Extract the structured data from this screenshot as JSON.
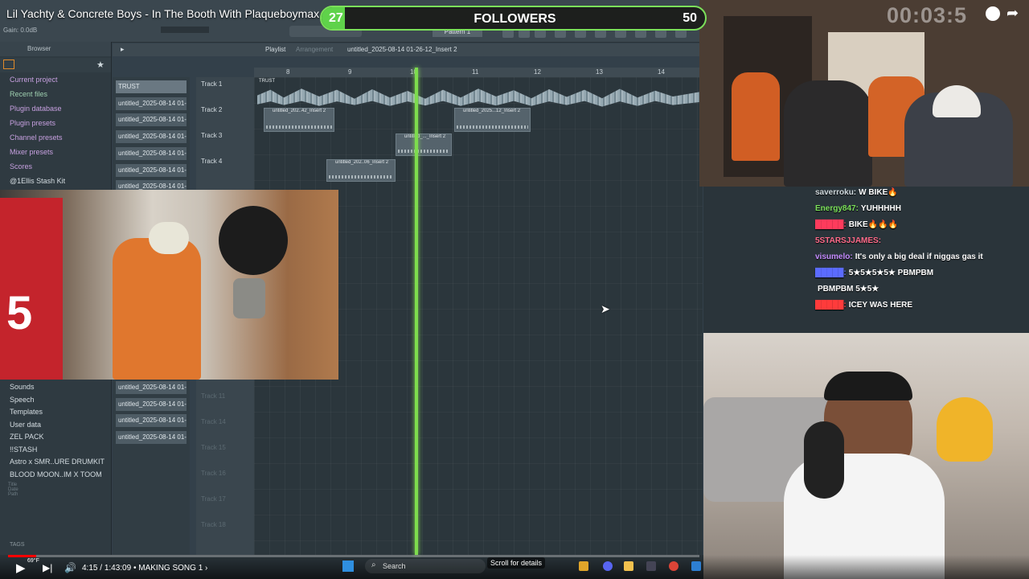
{
  "video": {
    "title": "Lil Yachty & Concrete Boys - In The Booth With Plaqueboymax",
    "current_time": "4:15",
    "duration": "1:43:09",
    "chapter": "MAKING SONG 1",
    "chapter_arrow": "›",
    "progress": 0.041,
    "stream_timer": "00:03:5",
    "weather": "69°F"
  },
  "followers": {
    "left": "27",
    "label": "FOLLOWERS",
    "right": "50",
    "fill": 0.06
  },
  "fl": {
    "gain": "Gain: 0.0dB",
    "browser_label": "Browser",
    "playlist_label": "Playlist",
    "arrangement": "Arrangement",
    "pattern_name": "untitled_2025-08-14 01-26-12_Insert 2",
    "pattern_select": "Pattern 1",
    "browser_items": [
      {
        "label": "Current project",
        "style": "p"
      },
      {
        "label": "Recent files",
        "style": "g"
      },
      {
        "label": "Plugin database",
        "style": "p"
      },
      {
        "label": "Plugin presets",
        "style": "p"
      },
      {
        "label": "Channel presets",
        "style": "p"
      },
      {
        "label": "Mixer presets",
        "style": "p"
      },
      {
        "label": "Scores",
        "style": "p"
      },
      {
        "label": "@1Ellis Stash Kit",
        "style": "w"
      }
    ],
    "browser_items_lower": [
      {
        "label": "Sounds",
        "style": "w"
      },
      {
        "label": "Speech",
        "style": "w"
      },
      {
        "label": "Templates",
        "style": "w"
      },
      {
        "label": "User data",
        "style": "w"
      },
      {
        "label": "ZEL PACK",
        "style": "w"
      },
      {
        "label": "!!STASH",
        "style": "w"
      },
      {
        "label": "Astro x SMR..URE DRUMKIT",
        "style": "w"
      },
      {
        "label": "BLOOD MOON..IM X TOOM",
        "style": "w"
      }
    ],
    "tags_label": "TAGS",
    "patterns_top": [
      "TRUST",
      "untitled_2025-08-14 01-",
      "untitled_2025-08-14 01-",
      "untitled_2025-08-14 01-",
      "untitled_2025-08-14 01-",
      "untitled_2025-08-14 01-",
      "untitled_2025-08-14 01-"
    ],
    "patterns_bottom": [
      "untitled_2025-08-14 01-",
      "untitled_2025-08-14 01-",
      "untitled_2025-08-14 01-",
      "untitled_2025-08-14 01-"
    ],
    "tracks": [
      "Track 1",
      "Track 2",
      "Track 3",
      "Track 4"
    ],
    "tracks_dim": [
      "Track 11",
      "Track 14",
      "Track 15",
      "Track 16",
      "Track 17",
      "Track 18"
    ],
    "ruler": [
      "8",
      "9",
      "10",
      "11",
      "12",
      "13",
      "14"
    ],
    "clips": {
      "trust": "TRUST",
      "c2a": "untitled_202..42_Insert 2",
      "c2b": "untitled_2025...12_Insert 2",
      "c3": "untitled_..._Insert 2",
      "c4": "untitled_202..06_Insert 2"
    }
  },
  "chat": [
    {
      "user": "saverroku:",
      "text": "W BIKE🔥",
      "color": "#cfd8dc"
    },
    {
      "user": "Energy847:",
      "text": "YUHHHHH",
      "color": "#7be05a"
    },
    {
      "user": "█████:",
      "text": "BIKE🔥🔥🔥",
      "color": "#ff3b5c"
    },
    {
      "user": "5STARSJJAMES:",
      "text": "",
      "color": "#ff6b8a"
    },
    {
      "user": "visumelo:",
      "text": "It's only a big deal if niggas gas it",
      "color": "#c58cff"
    },
    {
      "user": "█████:",
      "text": "5★5★5★5★ PBMPBM",
      "color": "#5b6bff"
    },
    {
      "user": "",
      "text": "PBMPBM 5★5★",
      "color": "#e04ccf"
    },
    {
      "user": "█████:",
      "text": "ICEY WAS HERE",
      "color": "#ff3b3b"
    }
  ],
  "taskbar": {
    "search": "Search",
    "scroll": "Scroll for details"
  }
}
